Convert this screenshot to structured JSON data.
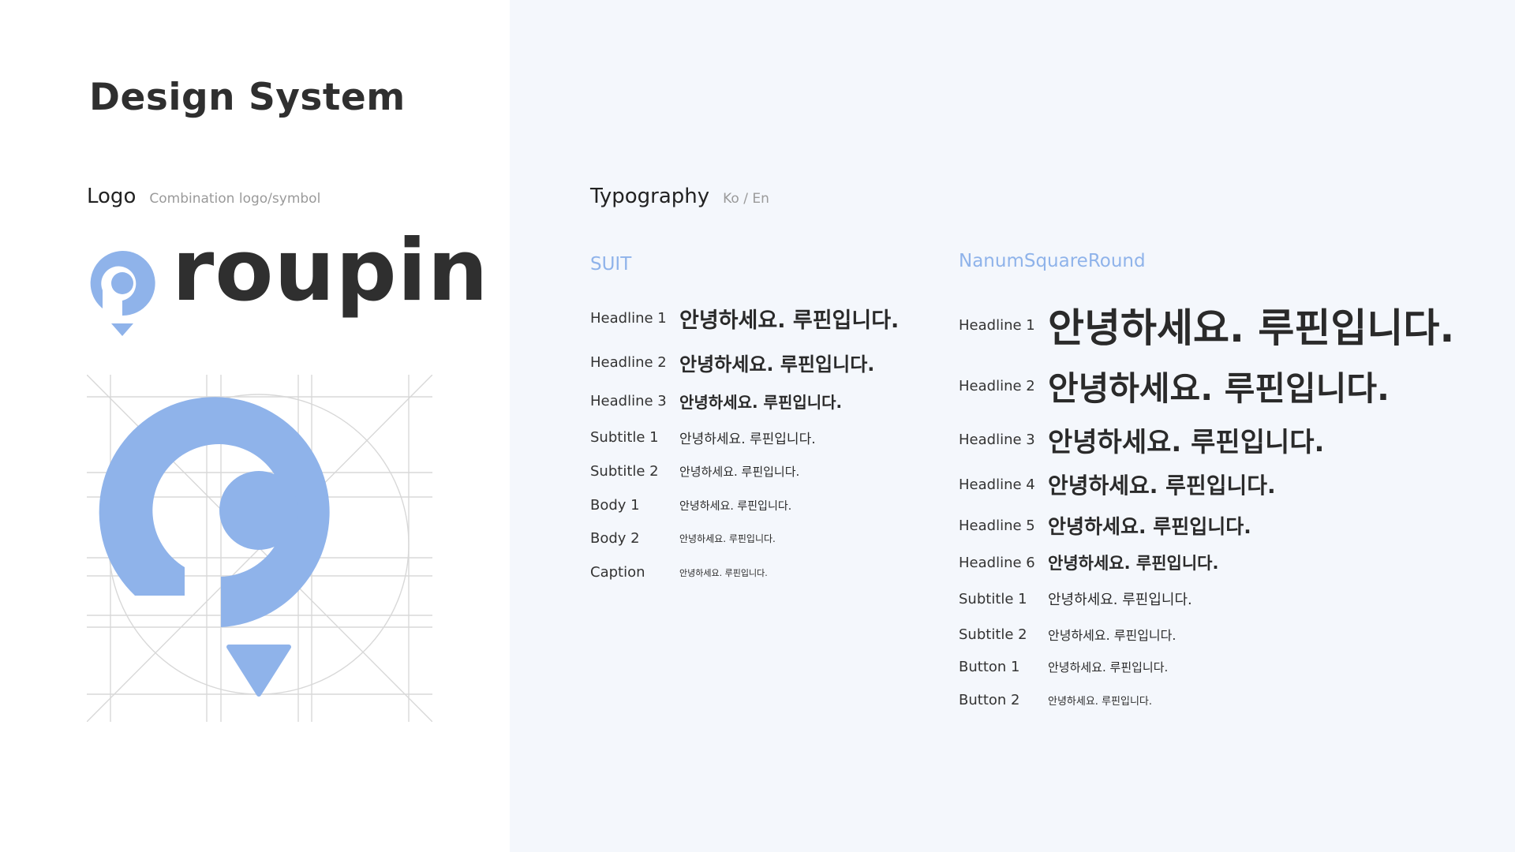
{
  "page_title": "Design System",
  "logo_section": {
    "title": "Logo",
    "subtitle": "Combination logo/symbol",
    "wordmark": "roupin",
    "brand_color": "#8fb3ea",
    "wordmark_color": "#2f2f2f"
  },
  "typography_section": {
    "title": "Typography",
    "subtitle": "Ko / En",
    "suit": {
      "font_name": "SUIT",
      "rows": [
        {
          "label": "Headline 1",
          "sample": "안녕하세요. 루핀입니다."
        },
        {
          "label": "Headline 2",
          "sample": "안녕하세요. 루핀입니다."
        },
        {
          "label": "Headline 3",
          "sample": "안녕하세요. 루핀입니다."
        },
        {
          "label": "Subtitle 1",
          "sample": "안녕하세요. 루핀입니다."
        },
        {
          "label": "Subtitle 2",
          "sample": "안녕하세요. 루핀입니다."
        },
        {
          "label": "Body 1",
          "sample": "안녕하세요. 루핀입니다."
        },
        {
          "label": "Body 2",
          "sample": "안녕하세요. 루핀입니다."
        },
        {
          "label": "Caption",
          "sample": "안녕하세요. 루핀입니다."
        }
      ]
    },
    "nanum": {
      "font_name": "NanumSquareRound",
      "rows": [
        {
          "label": "Headline 1",
          "sample": "안녕하세요. 루핀입니다."
        },
        {
          "label": "Headline 2",
          "sample": "안녕하세요. 루핀입니다."
        },
        {
          "label": "Headline 3",
          "sample": "안녕하세요. 루핀입니다."
        },
        {
          "label": "Headline 4",
          "sample": "안녕하세요. 루핀입니다."
        },
        {
          "label": "Headline 5",
          "sample": "안녕하세요. 루핀입니다."
        },
        {
          "label": "Headline 6",
          "sample": "안녕하세요. 루핀입니다."
        },
        {
          "label": "Subtitle 1",
          "sample": "안녕하세요. 루핀입니다."
        },
        {
          "label": "Subtitle 2",
          "sample": "안녕하세요. 루핀입니다."
        },
        {
          "label": "Button 1",
          "sample": "안녕하세요. 루핀입니다."
        },
        {
          "label": "Button 2",
          "sample": "안녕하세요. 루핀입니다."
        }
      ]
    }
  }
}
